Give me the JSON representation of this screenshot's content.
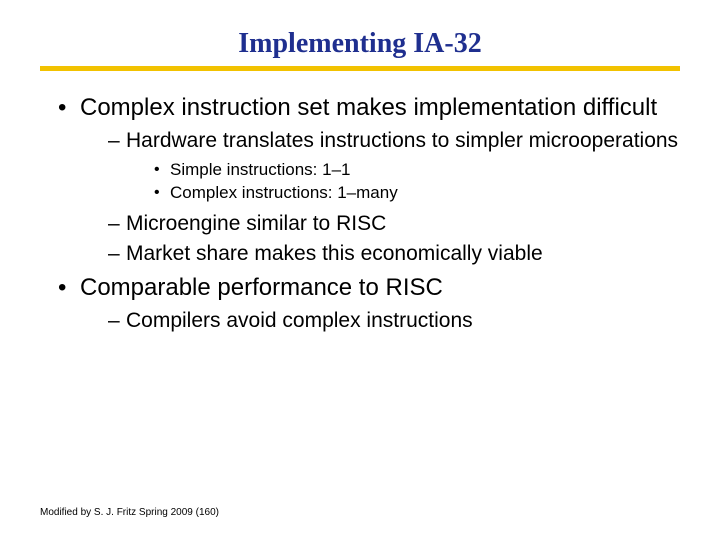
{
  "title": "Implementing IA-32",
  "bullets": {
    "b0": "Complex instruction set makes implementation difficult",
    "b0_sub": {
      "s0": "Hardware translates instructions to simpler microoperations",
      "s0_sub": {
        "t0": "Simple instructions: 1–1",
        "t1": "Complex instructions: 1–many"
      },
      "s1": "Microengine similar to RISC",
      "s2": "Market share makes this economically viable"
    },
    "b1": "Comparable performance to RISC",
    "b1_sub": {
      "s0": "Compilers avoid complex instructions"
    }
  },
  "footer": "Modified by S. J. Fritz  Spring 2009 (160)"
}
